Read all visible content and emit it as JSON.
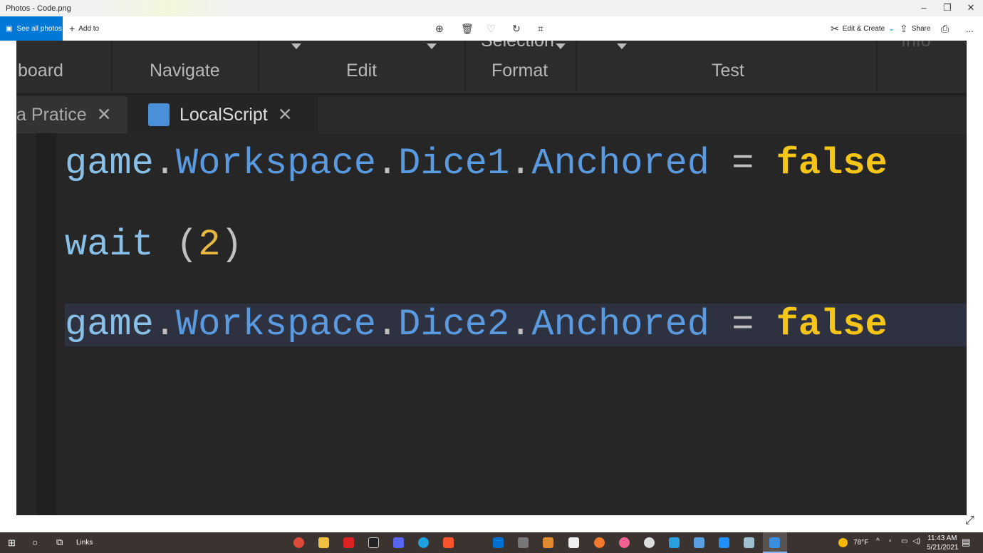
{
  "window": {
    "title": "Photos - Code.png"
  },
  "toolbar": {
    "see_all": "See all photos",
    "add_to": "Add to",
    "edit_create": "Edit & Create",
    "share": "Share",
    "more": "..."
  },
  "ribbon": {
    "items": [
      "board",
      "Navigate",
      "Edit",
      "Format",
      "Test"
    ],
    "partial": [
      "Selection",
      "Info"
    ]
  },
  "tabs": [
    {
      "label": "a Pratice"
    },
    {
      "label": "LocalScript",
      "active": true
    }
  ],
  "code": {
    "line1": {
      "obj": "game",
      "dot1": ".",
      "ws": "Workspace",
      "dot2": ".",
      "part": "Dice1",
      "dot3": ".",
      "prop": "Anchored",
      "op": " = ",
      "val": "false"
    },
    "line2": {
      "fn": "wait",
      "open": " (",
      "num": "2",
      "close": ")"
    },
    "line3": {
      "obj": "game",
      "dot1": ".",
      "ws": "Workspace",
      "dot2": ".",
      "part": "Dice2",
      "dot3": ".",
      "prop": "Anchored",
      "op": " = ",
      "val": "false"
    }
  },
  "taskbar": {
    "links": "Links",
    "weather": "78°F",
    "time": "11:43 AM",
    "date": "5/21/2021"
  }
}
